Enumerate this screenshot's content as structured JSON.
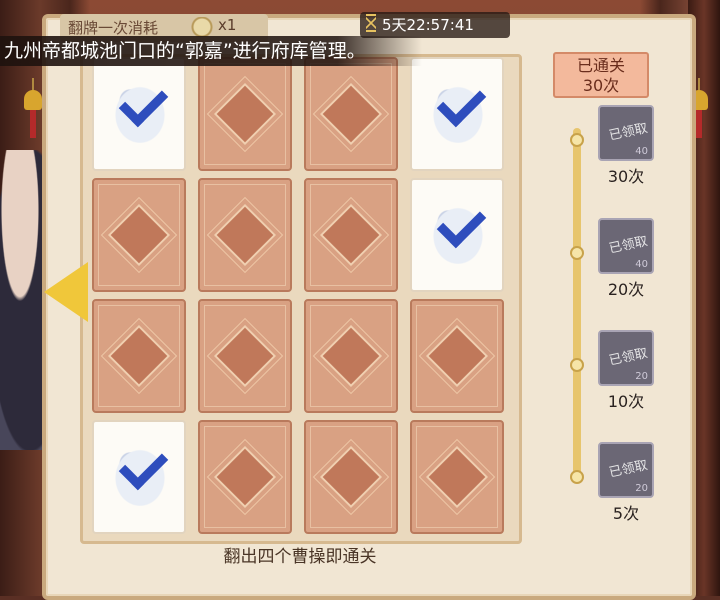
{
  "header": {
    "cost_label": "翻牌一次消耗",
    "cost_amount": "x1",
    "timer": "5天22:57:41"
  },
  "banner": {
    "text": "九州帝都城池门口的“郭嘉”进行府库管理。"
  },
  "board": {
    "rows": [
      [
        "face",
        "back",
        "back",
        "face"
      ],
      [
        "back",
        "back",
        "back",
        "face"
      ],
      [
        "back",
        "back",
        "back",
        "back"
      ],
      [
        "face",
        "back",
        "back",
        "back"
      ]
    ],
    "hint": "翻出四个曹操即通关"
  },
  "progress": {
    "cleared_label": "已通关",
    "cleared_count": "30次",
    "rewards": [
      {
        "label": "30次",
        "status": "已领取",
        "qty": "40"
      },
      {
        "label": "20次",
        "status": "已领取",
        "qty": "40"
      },
      {
        "label": "10次",
        "status": "已领取",
        "qty": "20"
      },
      {
        "label": "5次",
        "status": "已领取",
        "qty": "20"
      }
    ]
  },
  "colors": {
    "card_back": "#d9a183",
    "card_face": "#fdfbf6",
    "check": "#2e4dbd",
    "track": "#e7c56d",
    "cleared_box": "#f3b99c"
  },
  "icons": [
    "hourglass-icon",
    "coin-icon",
    "check-icon",
    "bell-icon",
    "arrow-left-icon"
  ]
}
